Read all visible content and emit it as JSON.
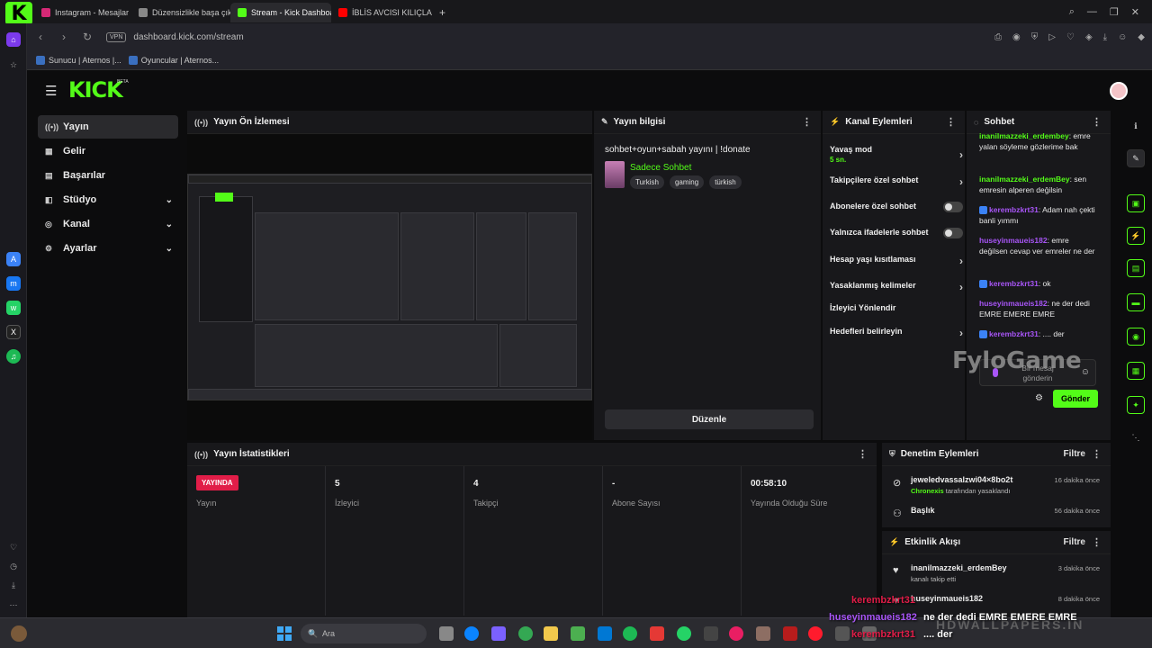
{
  "browser": {
    "tabs": [
      {
        "label": "Instagram - Mesajlar",
        "color": "#d62976"
      },
      {
        "label": "Düzensizlikle başa çıkma",
        "color": "#888888"
      },
      {
        "label": "Stream - Kick Dashboard",
        "color": "#53fc18"
      },
      {
        "label": "İBLİS AVCISI KILIÇLARI Yaş",
        "color": "#ff0000"
      }
    ],
    "vpn": "VPN",
    "url": "dashboard.kick.com/stream",
    "bookmarks": [
      "Sunucu | Aternos |...",
      "Oyuncular | Aternos..."
    ]
  },
  "kick": {
    "brand": "KICK",
    "beta": "BETA",
    "nav": [
      {
        "label": "Yayın",
        "icon": "broadcast-icon",
        "glyph": "((•))"
      },
      {
        "label": "Gelir",
        "icon": "revenue-icon",
        "glyph": "▦"
      },
      {
        "label": "Başarılar",
        "icon": "achievements-icon",
        "glyph": "▤"
      },
      {
        "label": "Stüdyo",
        "icon": "studio-icon",
        "glyph": "◧"
      },
      {
        "label": "Kanal",
        "icon": "channel-icon",
        "glyph": "◎"
      },
      {
        "label": "Ayarlar",
        "icon": "settings-icon",
        "glyph": "⚙"
      }
    ]
  },
  "preview": {
    "title": "Yayın Ön İzlemesi"
  },
  "info": {
    "header": "Yayın bilgisi",
    "stream_title": "sohbet+oyun+sabah yayını | !donate",
    "category": "Sadece Sohbet",
    "tags": [
      "Turkish",
      "gaming",
      "türkish"
    ],
    "edit_label": "Düzenle"
  },
  "channel": {
    "header": "Kanal Eylemleri",
    "slow_mode": "Yavaş mod",
    "slow_mode_value": "5 sn.",
    "followers_only": "Takipçilere özel sohbet",
    "subs_only": "Abonelere özel sohbet",
    "emotes_only": "Yalnızca ifadelerle sohbet",
    "account_age": "Hesap yaşı kısıtlaması",
    "banned_words": "Yasaklanmış kelimeler",
    "redirect": "İzleyici Yönlendir",
    "goals": "Hedefleri belirleyin"
  },
  "chat": {
    "header": "Sohbet",
    "messages": [
      {
        "user": "inanilmazzeki_erdembey",
        "color": "#53fc18",
        "text": "emre yalan söyleme gözlerime bak",
        "badge": false
      },
      {
        "user": "inanilmazzeki_erdemBey",
        "color": "#53fc18",
        "text": "sen emresin alperen değilsin",
        "badge": false
      },
      {
        "user": "kerembzkrt31",
        "color": "#a855f7",
        "text": "Adam nah çekti banli yımmı",
        "badge": true
      },
      {
        "user": "huseyinmaueis182",
        "color": "#a855f7",
        "text": "emre değilsen cevap ver emreler ne der",
        "badge": false
      },
      {
        "user": "kerembzkrt31",
        "color": "#a855f7",
        "text": "ok",
        "badge": true
      },
      {
        "user": "huseyinmaueis182",
        "color": "#a855f7",
        "text": "ne der dedi EMRE EMERE EMRE",
        "badge": false
      },
      {
        "user": "kerembzkrt31",
        "color": "#a855f7",
        "text": ".... der",
        "badge": true
      }
    ],
    "placeholder": "Bir mesaj gönderin",
    "send_label": "Gönder"
  },
  "stats": {
    "header": "Yayın İstatistikleri",
    "live_badge": "YAYINDA",
    "items": [
      {
        "value": "",
        "label": "Yayın"
      },
      {
        "value": "5",
        "label": "İzleyici"
      },
      {
        "value": "4",
        "label": "Takipçi"
      },
      {
        "value": "-",
        "label": "Abone Sayısı"
      },
      {
        "value": "00:58:10",
        "label": "Yayında Olduğu Süre"
      }
    ]
  },
  "moderation": {
    "header": "Denetim Eylemleri",
    "filter": "Filtre",
    "rows": [
      {
        "title": "jeweledvassalzwi04×8bo2t",
        "sub_user": "Chronexis",
        "sub_text": "tarafından yasaklandı",
        "time": "16 dakika önce"
      },
      {
        "title": "Başlık",
        "sub_user": "",
        "sub_text": "",
        "time": "56 dakika önce"
      }
    ]
  },
  "activity": {
    "header": "Etkinlik Akışı",
    "filter": "Filtre",
    "rows": [
      {
        "title": "inanilmazzeki_erdemBey",
        "sub": "kanalı takip etti",
        "time": "3 dakika önce"
      },
      {
        "title": "huseyinmaueis182",
        "sub": "",
        "time": "8 dakika önce"
      }
    ]
  },
  "overlay": {
    "watermark": "FyloGame",
    "hd": "HDWALLPAPERS.IN",
    "lines": [
      {
        "text": "kerembzkrt31",
        "color": "#e11d48"
      },
      {
        "text": "huseyinmaueis182",
        "color": "#a855f7"
      },
      {
        "text": "ne der dedi EMRE EMERE EMRE",
        "color": "#ffffff"
      },
      {
        "text": "kerembzkrt31",
        "color": "#e11d48"
      },
      {
        "text": ".... der",
        "color": "#ffffff"
      }
    ]
  },
  "taskbar": {
    "search": "Ara"
  }
}
